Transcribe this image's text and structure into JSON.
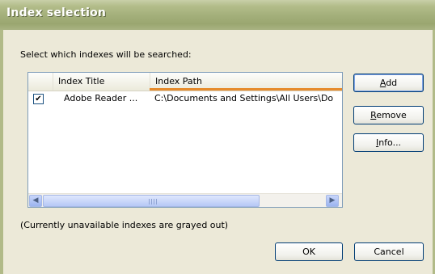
{
  "window": {
    "title": "Index selection"
  },
  "prompt": "Select which indexes will be searched:",
  "listview": {
    "columns": [
      "",
      "Index Title",
      "Index Path"
    ],
    "rows": [
      {
        "checked": true,
        "title": "Adobe Reader ...",
        "path": "C:\\Documents and Settings\\All Users\\Do"
      }
    ],
    "check_glyph": "✔"
  },
  "buttons": {
    "add": {
      "underline": "A",
      "rest": "dd"
    },
    "remove": {
      "underline": "R",
      "rest": "emove"
    },
    "info": {
      "underline": "I",
      "rest": "nfo..."
    },
    "ok": "OK",
    "cancel": "Cancel"
  },
  "scroll_left_glyph": "◀",
  "scroll_right_glyph": "▶",
  "note": "(Currently unavailable indexes are grayed out)"
}
